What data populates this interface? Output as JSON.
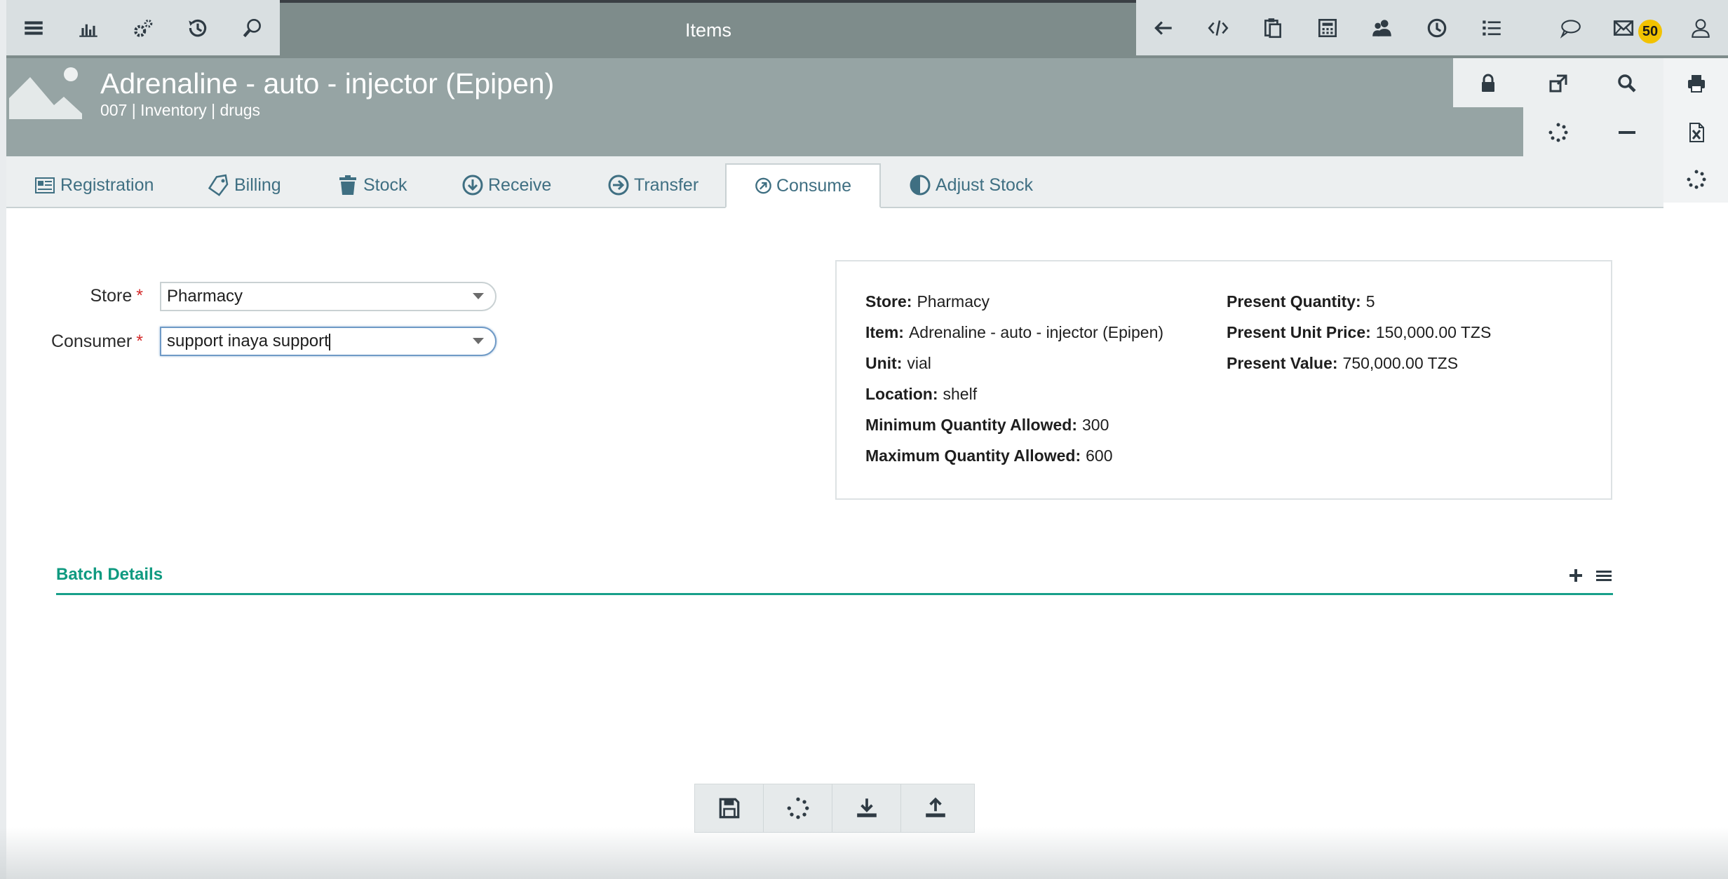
{
  "app": {
    "title": "Items"
  },
  "topbar": {
    "left_icons": [
      "menu-icon",
      "chart-icon",
      "settings-icon",
      "history-icon",
      "search-icon"
    ],
    "right_icons": [
      "back-arrow-icon",
      "code-icon",
      "clipboard-icon",
      "calculator-icon",
      "users-icon",
      "clock-icon",
      "list-icon"
    ],
    "message_badge": "50"
  },
  "header": {
    "title": "Adrenaline - auto - injector (Epipen)",
    "subtitle": "007 | Inventory | drugs"
  },
  "tabs": [
    {
      "label": "Registration",
      "icon": "registration-icon"
    },
    {
      "label": "Billing",
      "icon": "tag-icon"
    },
    {
      "label": "Stock",
      "icon": "trash-icon"
    },
    {
      "label": "Receive",
      "icon": "arrow-down-circle-icon"
    },
    {
      "label": "Transfer",
      "icon": "arrow-right-circle-icon"
    },
    {
      "label": "Consume",
      "icon": "arrow-upright-circle-icon"
    },
    {
      "label": "Adjust Stock",
      "icon": "contrast-icon"
    }
  ],
  "form": {
    "store_label": "Store",
    "store_value": "Pharmacy",
    "consumer_label": "Consumer",
    "consumer_value": "support inaya support",
    "required_mark": "*"
  },
  "info": {
    "store": {
      "label": "Store:",
      "value": "Pharmacy"
    },
    "item": {
      "label": "Item:",
      "value": "Adrenaline - auto - injector (Epipen)"
    },
    "unit": {
      "label": "Unit:",
      "value": "vial"
    },
    "location": {
      "label": "Location:",
      "value": "shelf"
    },
    "min_qty": {
      "label": "Minimum Quantity Allowed:",
      "value": "300"
    },
    "max_qty": {
      "label": "Maximum Quantity Allowed:",
      "value": "600"
    },
    "present_qty": {
      "label": "Present Quantity:",
      "value": "5"
    },
    "present_unit_price": {
      "label": "Present Unit Price:",
      "value": "150,000.00 TZS"
    },
    "present_value": {
      "label": "Present Value:",
      "value": "750,000.00 TZS"
    }
  },
  "batch": {
    "title": "Batch Details"
  },
  "colors": {
    "accent": "#18a08a",
    "tab_text": "#3f6f82",
    "header": "#96a4a4",
    "topbar": "#7e8c8b",
    "badge": "#f2c200"
  }
}
